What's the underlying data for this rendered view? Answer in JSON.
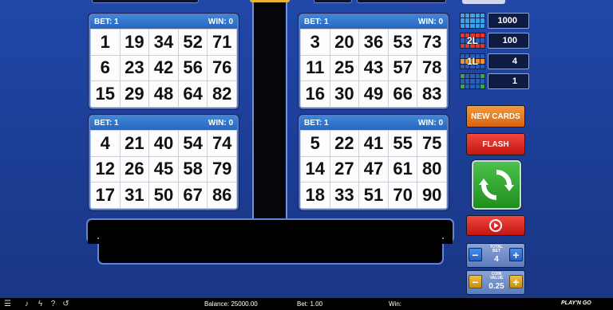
{
  "cards": [
    {
      "bet": "BET: 1",
      "win": "WIN: 0",
      "numbers": [
        1,
        19,
        34,
        52,
        71,
        6,
        23,
        42,
        56,
        76,
        15,
        29,
        48,
        64,
        82
      ]
    },
    {
      "bet": "BET: 1",
      "win": "WIN: 0",
      "numbers": [
        3,
        20,
        36,
        53,
        73,
        11,
        25,
        43,
        57,
        78,
        16,
        30,
        49,
        66,
        83
      ]
    },
    {
      "bet": "BET: 1",
      "win": "WIN: 0",
      "numbers": [
        4,
        21,
        40,
        54,
        74,
        12,
        26,
        45,
        58,
        79,
        17,
        31,
        50,
        67,
        86
      ]
    },
    {
      "bet": "BET: 1",
      "win": "WIN: 0",
      "numbers": [
        5,
        22,
        41,
        55,
        75,
        14,
        27,
        47,
        61,
        80,
        18,
        33,
        51,
        70,
        90
      ]
    }
  ],
  "paytable": [
    {
      "label": "full-card",
      "icon_text": "",
      "value": "1000",
      "color": "#3fa0e8"
    },
    {
      "label": "two-lines",
      "icon_text": "2L",
      "value": "100",
      "color": "#e03a30"
    },
    {
      "label": "one-line",
      "icon_text": "1L",
      "value": "4",
      "color": "#f09030"
    },
    {
      "label": "four-corners",
      "icon_text": "",
      "value": "1",
      "color": "#3ea848"
    }
  ],
  "buttons": {
    "new_cards": "NEW CARDS",
    "flash": "FLASH"
  },
  "total_bet": {
    "label_line1": "TOTAL",
    "label_line2": "BET",
    "value": "4"
  },
  "coin_value": {
    "label_line1": "COIN",
    "label_line2": "VALUE",
    "value": "0.25"
  },
  "status": {
    "balance": "Balance: 25000.00",
    "bet": "Bet: 1.00",
    "win": "Win:",
    "brand": "PLAY'N GO"
  }
}
